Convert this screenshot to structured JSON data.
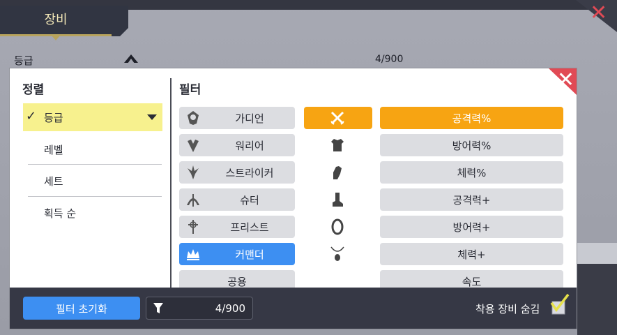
{
  "window": {
    "tab_title": "장비",
    "grade_label": "등급",
    "count_text": "4/900"
  },
  "sort": {
    "title": "정렬",
    "items": [
      {
        "label": "등급"
      },
      {
        "label": "레벨"
      },
      {
        "label": "세트"
      },
      {
        "label": "획득 순"
      }
    ]
  },
  "filter": {
    "title": "필터",
    "classes": [
      {
        "label": "가디언"
      },
      {
        "label": "워리어"
      },
      {
        "label": "스트라이커"
      },
      {
        "label": "슈터"
      },
      {
        "label": "프리스트"
      },
      {
        "label": "커맨더"
      },
      {
        "label": "공용"
      }
    ],
    "slots": [
      "weapon-icon",
      "armor-icon",
      "glove-icon",
      "boots-icon",
      "ring-icon",
      "necklace-icon"
    ],
    "stats": [
      {
        "label": "공격력%"
      },
      {
        "label": "방어력%"
      },
      {
        "label": "체력%"
      },
      {
        "label": "공격력+"
      },
      {
        "label": "방어력+"
      },
      {
        "label": "체력+"
      },
      {
        "label": "속도"
      }
    ]
  },
  "footer": {
    "reset_label": "필터 초기화",
    "count_text": "4/900",
    "hide_equipped_label": "착용 장비 숨김"
  },
  "colors": {
    "accent_blue": "#3d8ff2",
    "accent_orange": "#f7a412",
    "selected_yellow": "#f7f18e",
    "close_red": "#e14a55"
  }
}
